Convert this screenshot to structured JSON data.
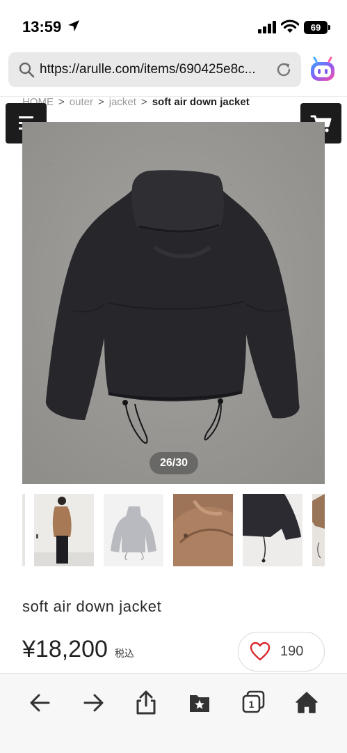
{
  "status_bar": {
    "time": "13:59",
    "battery": "69",
    "icons": [
      "location-arrow-icon",
      "cellular-signal-icon",
      "wifi-icon",
      "battery-icon"
    ]
  },
  "browser": {
    "url": "https://arulle.com/items/690425e8c...",
    "icons": [
      "search-icon",
      "reload-icon",
      "extension-icon"
    ]
  },
  "breadcrumb": {
    "items": [
      "HOME",
      "outer",
      "jacket"
    ],
    "current": "soft air down jacket"
  },
  "header": {
    "icons": [
      "hamburger-menu-icon",
      "cart-icon"
    ]
  },
  "gallery": {
    "counter": "26/30",
    "thumbnail_count": 6
  },
  "product": {
    "title": "soft air down jacket",
    "price": "¥18,200",
    "tax_label": "税込",
    "favorite_count": "190"
  },
  "toolbar": {
    "icons": [
      "back-arrow-icon",
      "forward-arrow-icon",
      "share-icon",
      "bookmarks-icon",
      "tabs-icon",
      "home-icon"
    ],
    "tabs_count": "1"
  },
  "colors": {
    "header_button_bg": "#1c1c1c",
    "heart": "#d9272e",
    "jacket": "#26262b",
    "concrete": "#9c9a96"
  }
}
